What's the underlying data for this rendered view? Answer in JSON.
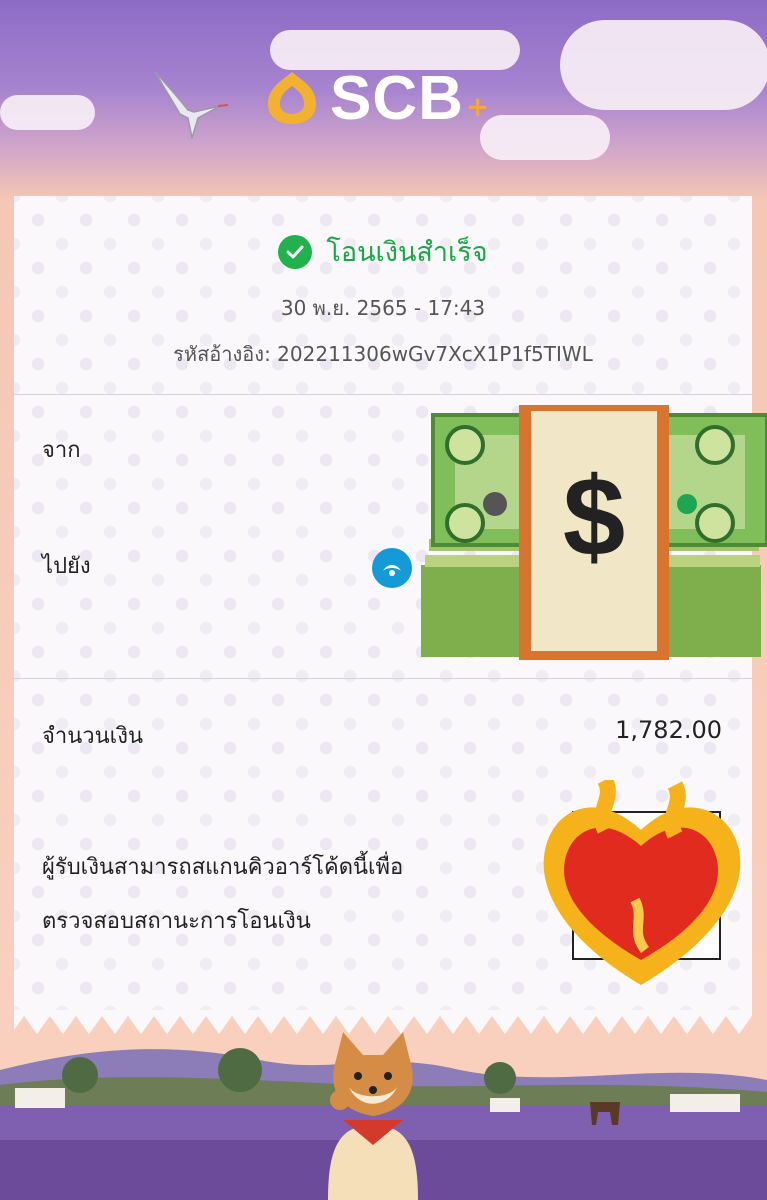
{
  "brand": {
    "logo_text": "SCB",
    "plus": "+"
  },
  "receipt": {
    "status": "โอนเงินสำเร็จ",
    "datetime": "30 พ.ย. 2565 - 17:43",
    "reference_label": "รหัสอ้างอิง:",
    "reference_value": "202211306wGv7XcX1P1f5TIWL",
    "from_label": "จาก",
    "to_label": "ไปยัง",
    "amount_label": "จำนวนเงิน",
    "amount_value": "1,782.00",
    "qr_note_line1": "ผู้รับเงินสามารถสแกนคิวอาร์โค้ดนี้เพื่อ",
    "qr_note_line2": "ตรวจสอบสถานะการโอนเงิน"
  },
  "icons": [
    "check-icon",
    "bank-logo-icon",
    "money-emoji",
    "heart-on-fire-emoji",
    "bird-illustration",
    "shiba-dog-illustration",
    "scb-logo-icon"
  ],
  "colors": {
    "success": "#21b24b",
    "brand_gold": "#f2b230",
    "bank_blue": "#149bd7"
  }
}
